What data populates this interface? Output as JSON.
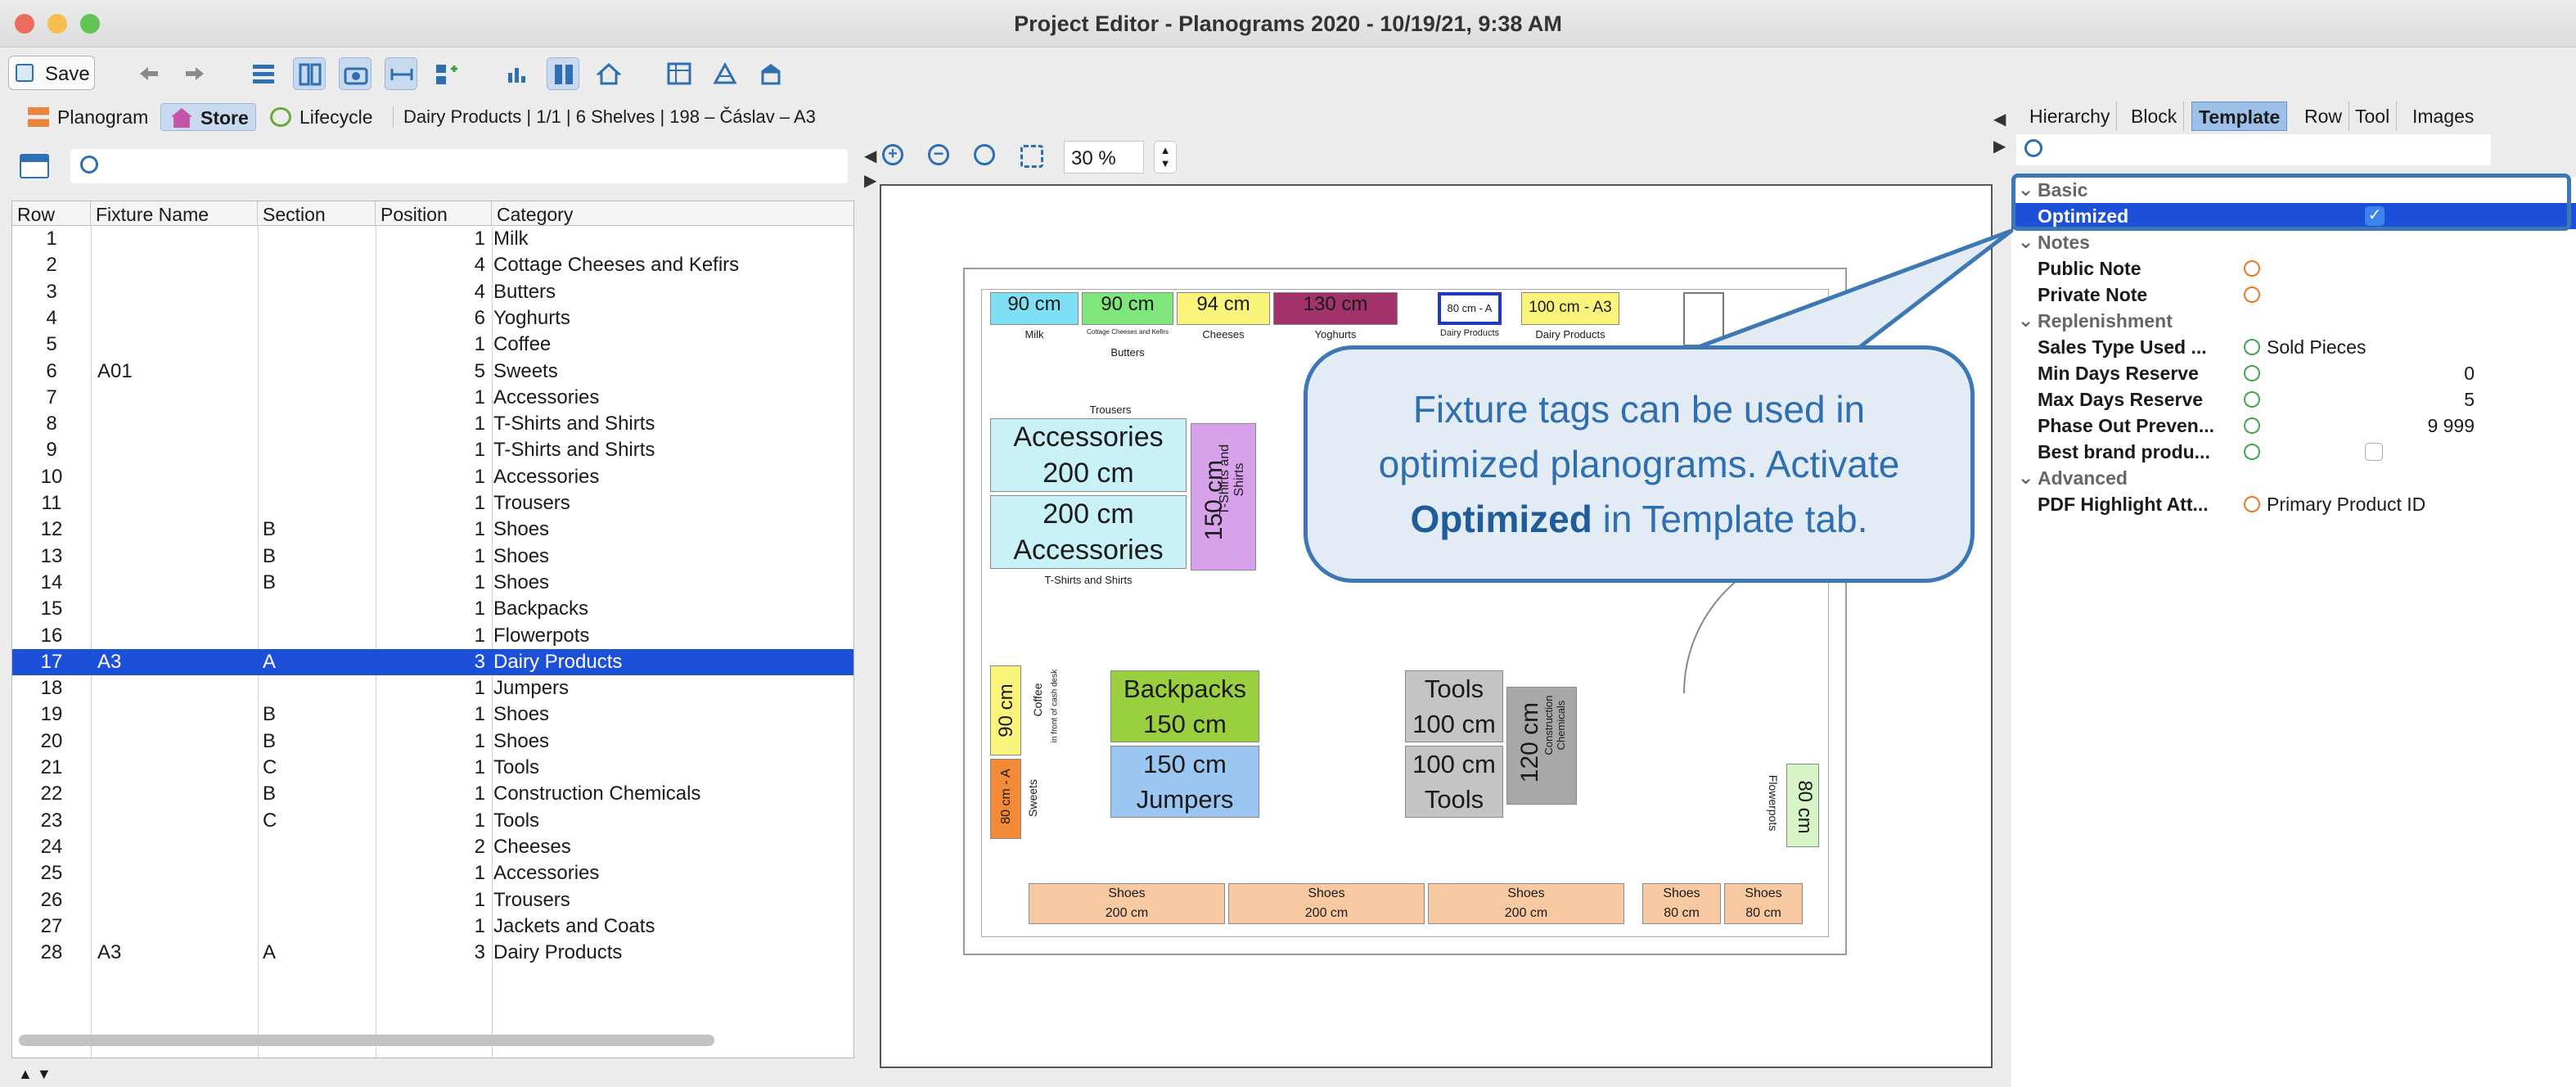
{
  "window": {
    "title": "Project Editor - Planograms 2020 - 10/19/21, 9:38 AM"
  },
  "toolbar": {
    "save_label": "Save"
  },
  "nav": {
    "planogram": "Planogram",
    "store": "Store",
    "lifecycle": "Lifecycle",
    "info": "Dairy Products | 1/1 | 6 Shelves | 198 – Čáslav – A3"
  },
  "zoom": {
    "value": "30 %"
  },
  "table": {
    "headers": [
      "Row",
      "Fixture Name",
      "Section",
      "Position",
      "Category"
    ],
    "rows": [
      {
        "row": "1",
        "fixture": "",
        "section": "",
        "position": "1",
        "category": "Milk"
      },
      {
        "row": "2",
        "fixture": "",
        "section": "",
        "position": "4",
        "category": "Cottage Cheeses and Kefirs"
      },
      {
        "row": "3",
        "fixture": "",
        "section": "",
        "position": "4",
        "category": "Butters"
      },
      {
        "row": "4",
        "fixture": "",
        "section": "",
        "position": "6",
        "category": "Yoghurts"
      },
      {
        "row": "5",
        "fixture": "",
        "section": "",
        "position": "1",
        "category": "Coffee"
      },
      {
        "row": "6",
        "fixture": "A01",
        "section": "",
        "position": "5",
        "category": "Sweets"
      },
      {
        "row": "7",
        "fixture": "",
        "section": "",
        "position": "1",
        "category": "Accessories"
      },
      {
        "row": "8",
        "fixture": "",
        "section": "",
        "position": "1",
        "category": "T-Shirts and Shirts"
      },
      {
        "row": "9",
        "fixture": "",
        "section": "",
        "position": "1",
        "category": "T-Shirts and Shirts"
      },
      {
        "row": "10",
        "fixture": "",
        "section": "",
        "position": "1",
        "category": "Accessories"
      },
      {
        "row": "11",
        "fixture": "",
        "section": "",
        "position": "1",
        "category": "Trousers"
      },
      {
        "row": "12",
        "fixture": "",
        "section": "B",
        "position": "1",
        "category": "Shoes"
      },
      {
        "row": "13",
        "fixture": "",
        "section": "B",
        "position": "1",
        "category": "Shoes"
      },
      {
        "row": "14",
        "fixture": "",
        "section": "B",
        "position": "1",
        "category": "Shoes"
      },
      {
        "row": "15",
        "fixture": "",
        "section": "",
        "position": "1",
        "category": "Backpacks"
      },
      {
        "row": "16",
        "fixture": "",
        "section": "",
        "position": "1",
        "category": "Flowerpots"
      },
      {
        "row": "17",
        "fixture": "A3",
        "section": "A",
        "position": "3",
        "category": "Dairy Products"
      },
      {
        "row": "18",
        "fixture": "",
        "section": "",
        "position": "1",
        "category": "Jumpers"
      },
      {
        "row": "19",
        "fixture": "",
        "section": "B",
        "position": "1",
        "category": "Shoes"
      },
      {
        "row": "20",
        "fixture": "",
        "section": "B",
        "position": "1",
        "category": "Shoes"
      },
      {
        "row": "21",
        "fixture": "",
        "section": "C",
        "position": "1",
        "category": "Tools"
      },
      {
        "row": "22",
        "fixture": "",
        "section": "B",
        "position": "1",
        "category": "Construction Chemicals"
      },
      {
        "row": "23",
        "fixture": "",
        "section": "C",
        "position": "1",
        "category": "Tools"
      },
      {
        "row": "24",
        "fixture": "",
        "section": "",
        "position": "2",
        "category": "Cheeses"
      },
      {
        "row": "25",
        "fixture": "",
        "section": "",
        "position": "1",
        "category": "Accessories"
      },
      {
        "row": "26",
        "fixture": "",
        "section": "",
        "position": "1",
        "category": "Trousers"
      },
      {
        "row": "27",
        "fixture": "",
        "section": "",
        "position": "1",
        "category": "Jackets and Coats"
      },
      {
        "row": "28",
        "fixture": "A3",
        "section": "A",
        "position": "3",
        "category": "Dairy Products"
      }
    ],
    "selected_row": "17"
  },
  "canvas": {
    "fixtures": {
      "milk_size": "90 cm",
      "milk_label": "Milk",
      "cottage_size": "90 cm",
      "cottage_label": "Cottage Cheeses and Kefirs",
      "butters_label": "Butters",
      "cheeses_size": "94 cm",
      "cheeses_label": "Cheeses",
      "yoghurts_size": "130 cm",
      "yoghurts_label": "Yoghurts",
      "dairy_sel_size": "80 cm - A",
      "dairy_sel_label": "Dairy Products",
      "dairy_size": "100 cm - A3",
      "dairy_label": "Dairy Products",
      "trousers_label": "Trousers",
      "acc1_name": "Accessories",
      "acc1_size": "200 cm",
      "acc2_size": "200 cm",
      "acc2_name": "Accessories",
      "tshirts_size": "150 cm",
      "tshirts_label": "T-Shirts and Shirts",
      "tshirts_bottom_label": "T-Shirts and Shirts",
      "coffee_size": "90 cm",
      "coffee_label": "Coffee",
      "cashdesk_label": "in front of cash desk",
      "sweets_size": "80 cm - A",
      "sweets_label": "Sweets",
      "backpacks_name": "Backpacks",
      "backpacks_size": "150 cm",
      "jumpers_size": "150 cm",
      "jumpers_name": "Jumpers",
      "tools1_name": "Tools",
      "tools1_size": "100 cm",
      "tools2_size": "100 cm",
      "tools2_name": "Tools",
      "constr_size": "120 cm",
      "constr_label": "Construction Chemicals",
      "flowerpots_size": "80 cm",
      "flowerpots_label": "Flowerpots",
      "shoes": [
        {
          "name": "Shoes",
          "size": "200 cm"
        },
        {
          "name": "Shoes",
          "size": "200 cm"
        },
        {
          "name": "Shoes",
          "size": "200 cm"
        },
        {
          "name": "Shoes",
          "size": "80 cm"
        },
        {
          "name": "Shoes",
          "size": "80 cm"
        }
      ]
    }
  },
  "right_tabs": [
    "Hierarchy",
    "Block",
    "Template",
    "Row",
    "Tool",
    "Images"
  ],
  "properties": {
    "basic": "Basic",
    "optimized": "Optimized",
    "notes": "Notes",
    "public_note": "Public Note",
    "private_note": "Private Note",
    "replenishment": "Replenishment",
    "sales_type": "Sales Type Used ...",
    "sales_type_val": "Sold Pieces",
    "min_days": "Min Days Reserve",
    "min_days_val": "0",
    "max_days": "Max Days Reserve",
    "max_days_val": "5",
    "phase_out": "Phase Out Preven...",
    "phase_out_val": "9 999",
    "best_brand": "Best brand produ...",
    "advanced": "Advanced",
    "pdf_highlight": "PDF Highlight Att...",
    "pdf_highlight_val": "Primary Product ID"
  },
  "callout": {
    "line1": "Fixture tags can be used in",
    "line2": "optimized planograms. Activate",
    "bold": "Optimized",
    "line3_rest": " in Template tab."
  },
  "colors": {
    "selection": "#1d50d8",
    "callout_border": "#3d78b4",
    "callout_text": "#2d6fb0"
  }
}
